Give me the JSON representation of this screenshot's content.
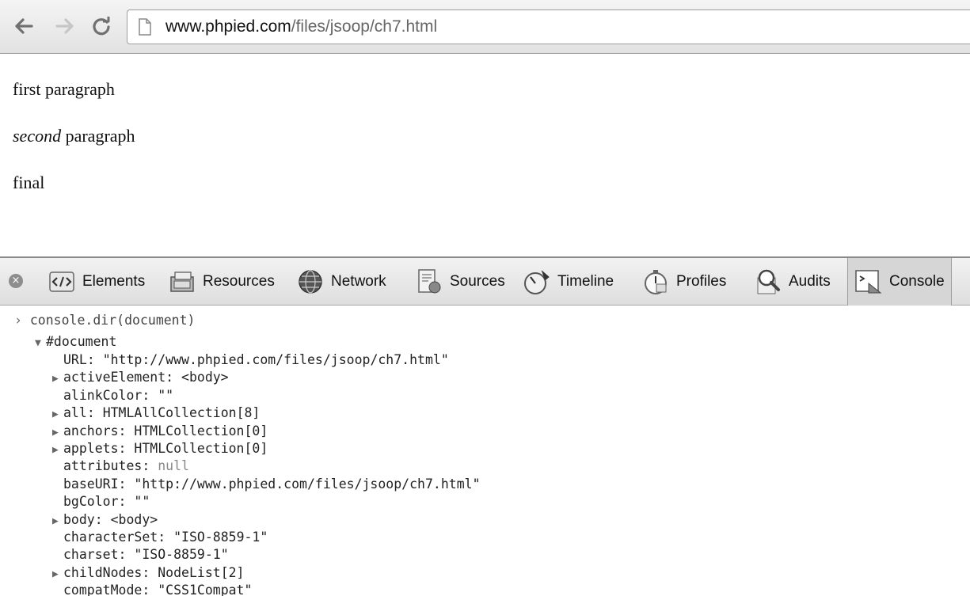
{
  "browser": {
    "url_host": "www.phpied.com",
    "url_path": "/files/jsoop/ch7.html"
  },
  "page": {
    "line1": "first paragraph",
    "line2_em": "second",
    "line2_rest": " paragraph",
    "line3": "final"
  },
  "devtools": {
    "tabs": [
      "Elements",
      "Resources",
      "Network",
      "Sources",
      "Timeline",
      "Profiles",
      "Audits",
      "Console"
    ],
    "active_tab": "Console"
  },
  "console": {
    "command": "console.dir(document)",
    "root": "#document",
    "props": [
      {
        "expand": false,
        "key": "URL",
        "val": "\"http://www.phpied.com/files/jsoop/ch7.html\""
      },
      {
        "expand": true,
        "key": "activeElement",
        "val": "<body>"
      },
      {
        "expand": false,
        "key": "alinkColor",
        "val": "\"\""
      },
      {
        "expand": true,
        "key": "all",
        "val": "HTMLAllCollection[8]"
      },
      {
        "expand": true,
        "key": "anchors",
        "val": "HTMLCollection[0]"
      },
      {
        "expand": true,
        "key": "applets",
        "val": "HTMLCollection[0]"
      },
      {
        "expand": false,
        "key": "attributes",
        "val": "null"
      },
      {
        "expand": false,
        "key": "baseURI",
        "val": "\"http://www.phpied.com/files/jsoop/ch7.html\""
      },
      {
        "expand": false,
        "key": "bgColor",
        "val": "\"\""
      },
      {
        "expand": true,
        "key": "body",
        "val": "<body>"
      },
      {
        "expand": false,
        "key": "characterSet",
        "val": "\"ISO-8859-1\""
      },
      {
        "expand": false,
        "key": "charset",
        "val": "\"ISO-8859-1\""
      },
      {
        "expand": true,
        "key": "childNodes",
        "val": "NodeList[2]"
      },
      {
        "expand": false,
        "key": "compatMode",
        "val": "\"CSS1Compat\""
      }
    ]
  }
}
